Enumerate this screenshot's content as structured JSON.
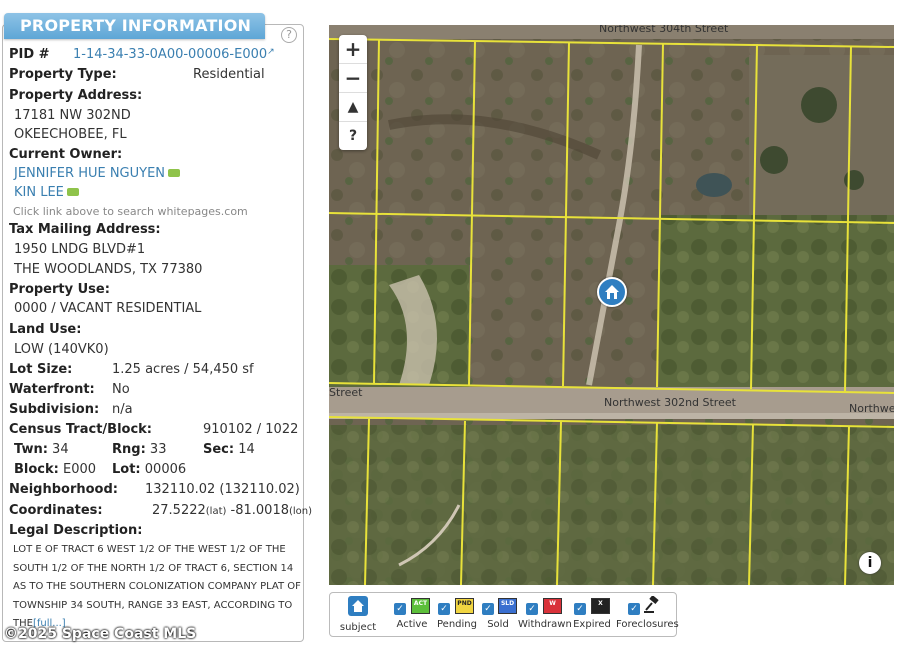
{
  "panel": {
    "title": "PROPERTY INFORMATION",
    "help": "?",
    "pid_label": "PID #",
    "pid_value": "1-14-34-33-0A00-00006-E000",
    "type_label": "Property Type:",
    "type_value": "Residential",
    "address_label": "Property Address:",
    "address_line1": "17181 NW 302ND",
    "address_line2": "OKEECHOBEE, FL",
    "owner_label": "Current Owner:",
    "owner1": "JENNIFER HUE NGUYEN",
    "owner2": "KIN LEE",
    "owner_hint": "Click link above to search whitepages.com",
    "mailing_label": "Tax Mailing Address:",
    "mailing_line1": "1950 LNDG BLVD#1",
    "mailing_line2": "THE WOODLANDS, TX 77380",
    "use_label": "Property Use:",
    "use_value": "0000 / VACANT RESIDENTIAL",
    "landuse_label": "Land Use:",
    "landuse_value": "LOW (140VK0)",
    "lot_label": "Lot Size:",
    "lot_value": "1.25 acres / 54,450 sf",
    "water_label": "Waterfront:",
    "water_value": "No",
    "subdiv_label": "Subdivision:",
    "subdiv_value": "n/a",
    "census_label": "Census Tract/Block:",
    "census_value": "910102 / 1022",
    "twn_label": "Twn:",
    "twn_value": "34",
    "rng_label": "Rng:",
    "rng_value": "33",
    "sec_label": "Sec:",
    "sec_value": "14",
    "block_label": "Block:",
    "block_value": "E000",
    "lotnum_label": "Lot:",
    "lotnum_value": "00006",
    "nbhd_label": "Neighborhood:",
    "nbhd_value": "132110.02 (132110.02)",
    "coord_label": "Coordinates:",
    "coord_lat": "27.5222",
    "coord_lat_unit": "(lat)",
    "coord_lon": "-81.0018",
    "coord_lon_unit": "(lon)",
    "legal_label": "Legal Description:",
    "legal_text": "LOT E OF TRACT 6 WEST 1/2 OF THE WEST 1/2 OF THE SOUTH 1/2 OF THE NORTH 1/2 OF TRACT 6, SECTION 14 AS TO THE SOUTHERN COLONIZATION COMPANY PLAT OF TOWNSHIP 34 SOUTH, RANGE 33 EAST, ACCORDING TO THE",
    "legal_more": "[full...]"
  },
  "map": {
    "zoom_in": "+",
    "zoom_out": "−",
    "compass": "▲",
    "help": "?",
    "street_main": "Northwest 302nd Street",
    "street_left": "Street",
    "street_right": "Northwest",
    "street_top": "Northwest 304th Street",
    "info": "i",
    "colors": {
      "parcel_line": "#e8e23a",
      "road": "#a79c8e",
      "marker": "#2f7ec1"
    }
  },
  "legend": {
    "subject": "subject",
    "items": [
      {
        "label": "Active",
        "tag": "ACT",
        "color": "#5cbf3a"
      },
      {
        "label": "Pending",
        "tag": "PND",
        "color": "#f1d541"
      },
      {
        "label": "Sold",
        "tag": "SLD",
        "color": "#3a6fd0"
      },
      {
        "label": "Withdrawn",
        "tag": "W",
        "color": "#d9323a"
      },
      {
        "label": "Expired",
        "tag": "X",
        "color": "#222222"
      },
      {
        "label": "Foreclosures",
        "tag": "",
        "color": "#222222"
      }
    ]
  },
  "copyright": "©2025 Space Coast MLS"
}
